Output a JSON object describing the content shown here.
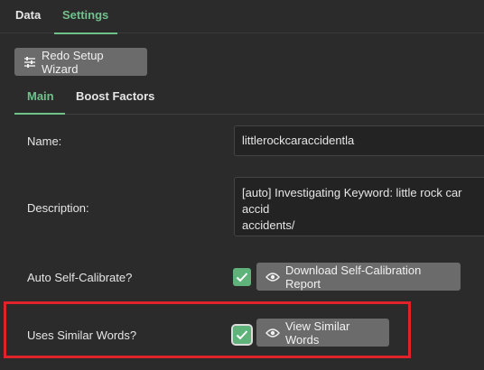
{
  "top_tabs": [
    {
      "label": "Data"
    },
    {
      "label": "Settings",
      "active": true
    }
  ],
  "redo_button": {
    "label": "Redo Setup Wizard",
    "icon": "sliders-icon"
  },
  "sub_tabs": [
    {
      "label": "Main",
      "active": true
    },
    {
      "label": "Boost Factors"
    }
  ],
  "form": {
    "name_label": "Name:",
    "name_value": "littlerockcaraccidentla",
    "description_label": "Description:",
    "description_value": "[auto] Investigating Keyword: little rock car accid\naccidents/",
    "auto_calibrate_label": "Auto Self-Calibrate?",
    "auto_calibrate_checked": true,
    "download_report_label": "Download Self-Calibration Report",
    "similar_words_label": "Uses Similar Words?",
    "similar_words_checked": true,
    "view_similar_label": "View Similar Words"
  },
  "colors": {
    "accent": "#6ec28a",
    "background": "#2b2b2b",
    "highlight": "#e0232a",
    "button": "#6b6b6b"
  }
}
